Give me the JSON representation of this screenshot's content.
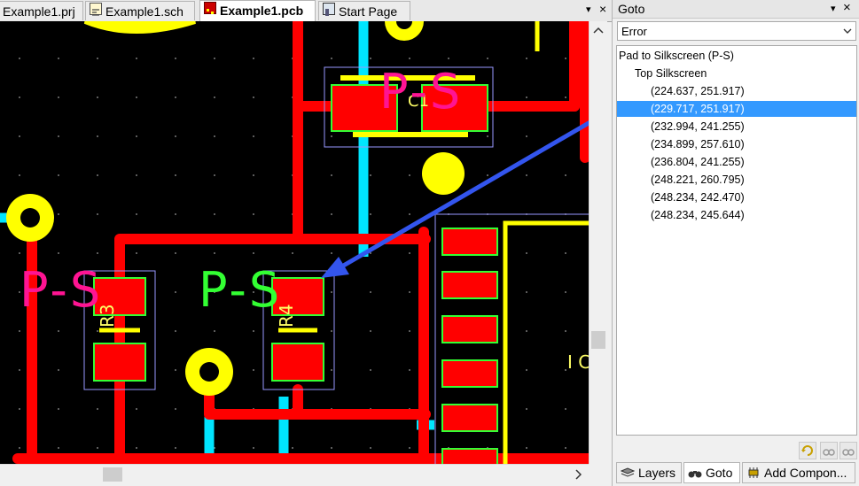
{
  "tabs": [
    {
      "label": "Example1.prj",
      "icon": "project-icon"
    },
    {
      "label": "Example1.sch",
      "icon": "schematic-icon"
    },
    {
      "label": "Example1.pcb",
      "icon": "pcb-icon",
      "active": true
    },
    {
      "label": "Start Page",
      "icon": "start-page-icon"
    }
  ],
  "tab_controls": {
    "menu": "▾",
    "close": "×"
  },
  "pcb": {
    "silk_labels": {
      "r3": "R3",
      "r4": "R4",
      "c1": "C1",
      "ic": "I C"
    },
    "error_markers": {
      "top": "P-S",
      "left": "P-S",
      "mid": "P-S"
    },
    "colors": {
      "background": "#000000",
      "track_red": "#ff0000",
      "track_cyan": "#00e5ff",
      "pad_yellow": "#ffff00",
      "silk_yellow": "#ffff00",
      "pad_outline_green": "#00ff00",
      "marker_pink": "#ff1493",
      "marker_green": "#33ff33",
      "courtyard": "#9999ff",
      "arrow": "#3355ee"
    }
  },
  "panel": {
    "title": "Goto",
    "title_controls": {
      "pin": "▾",
      "close": "×"
    },
    "dropdown_value": "Error",
    "tree": {
      "root": "Pad to Silkscreen  (P-S)",
      "child": "Top Silkscreen",
      "items": [
        "(224.637,  251.917)",
        "(229.717,  251.917)",
        "(232.994,  241.255)",
        "(234.899,  257.610)",
        "(236.804,  241.255)",
        "(248.221,  260.795)",
        "(248.234,  242.470)",
        "(248.234,  245.644)"
      ],
      "selected_index": 1
    },
    "bottom_tabs": [
      {
        "label": "Layers",
        "icon": "layers-icon"
      },
      {
        "label": "Goto",
        "icon": "binoculars-icon",
        "active": true
      },
      {
        "label": "Add Compon...",
        "icon": "add-component-icon"
      }
    ]
  }
}
